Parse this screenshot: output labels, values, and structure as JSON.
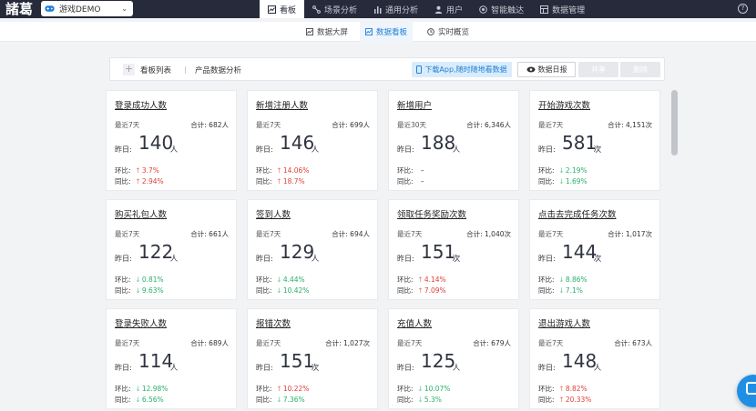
{
  "app": {
    "logo": "諸葛",
    "project": "游戏DEMO",
    "help": "?"
  },
  "topnav": [
    {
      "label": "看板",
      "icon": "dashboard-icon"
    },
    {
      "label": "场景分析",
      "icon": "scene-icon"
    },
    {
      "label": "通用分析",
      "icon": "bar-chart-icon"
    },
    {
      "label": "用户",
      "icon": "user-icon"
    },
    {
      "label": "智能触达",
      "icon": "target-icon"
    },
    {
      "label": "数据管理",
      "icon": "data-icon"
    }
  ],
  "subnav": [
    {
      "label": "数据大屏"
    },
    {
      "label": "数据看板"
    },
    {
      "label": "实时概览"
    }
  ],
  "toolbar": {
    "list_label": "看板列表",
    "dashboard_name": "产品数据分析",
    "download_app": "下载App,随时随地看数据",
    "daily_report": "数据日报",
    "share": "共享",
    "delete": "删除"
  },
  "labels": {
    "yesterday": "昨日:",
    "ring": "环比:",
    "yoy": "同比:"
  },
  "cards": [
    {
      "title": "登录成功人数",
      "period": "最近7天",
      "total": "合计: 682人",
      "value": "140",
      "unit": "人",
      "ring": "3.7%",
      "ring_dir": "up",
      "yoy": "2.94%",
      "yoy_dir": "up"
    },
    {
      "title": "新增注册人数",
      "period": "最近7天",
      "total": "合计: 699人",
      "value": "146",
      "unit": "人",
      "ring": "14.06%",
      "ring_dir": "up",
      "yoy": "18.7%",
      "yoy_dir": "up"
    },
    {
      "title": "新增用户",
      "period": "最近30天",
      "total": "合计: 6,346人",
      "value": "188",
      "unit": "人",
      "ring": "–",
      "ring_dir": "none",
      "yoy": "–",
      "yoy_dir": "none"
    },
    {
      "title": "开始游戏次数",
      "period": "最近7天",
      "total": "合计: 4,151次",
      "value": "581",
      "unit": "次",
      "ring": "2.19%",
      "ring_dir": "down",
      "yoy": "1.69%",
      "yoy_dir": "down"
    },
    {
      "title": "购买礼包人数",
      "period": "最近7天",
      "total": "合计: 661人",
      "value": "122",
      "unit": "人",
      "ring": "0.81%",
      "ring_dir": "down",
      "yoy": "9.63%",
      "yoy_dir": "down"
    },
    {
      "title": "签到人数",
      "period": "最近7天",
      "total": "合计: 694人",
      "value": "129",
      "unit": "人",
      "ring": "4.44%",
      "ring_dir": "down",
      "yoy": "10.42%",
      "yoy_dir": "down"
    },
    {
      "title": "领取任务奖励次数",
      "period": "最近7天",
      "total": "合计: 1,040次",
      "value": "151",
      "unit": "次",
      "ring": "4.14%",
      "ring_dir": "up",
      "yoy": "7.09%",
      "yoy_dir": "up"
    },
    {
      "title": "点击去完成任务次数",
      "period": "最近7天",
      "total": "合计: 1,017次",
      "value": "144",
      "unit": "次",
      "ring": "8.86%",
      "ring_dir": "down",
      "yoy": "7.1%",
      "yoy_dir": "down"
    },
    {
      "title": "登录失败人数",
      "period": "最近7天",
      "total": "合计: 689人",
      "value": "114",
      "unit": "人",
      "ring": "12.98%",
      "ring_dir": "down",
      "yoy": "6.56%",
      "yoy_dir": "down"
    },
    {
      "title": "报错次数",
      "period": "最近7天",
      "total": "合计: 1,027次",
      "value": "151",
      "unit": "次",
      "ring": "10.22%",
      "ring_dir": "up",
      "yoy": "7.36%",
      "yoy_dir": "down"
    },
    {
      "title": "充值人数",
      "period": "最近7天",
      "total": "合计: 679人",
      "value": "125",
      "unit": "人",
      "ring": "10.07%",
      "ring_dir": "down",
      "yoy": "5.3%",
      "yoy_dir": "down"
    },
    {
      "title": "退出游戏人数",
      "period": "最近7天",
      "total": "合计: 673人",
      "value": "148",
      "unit": "人",
      "ring": "8.82%",
      "ring_dir": "up",
      "yoy": "20.33%",
      "yoy_dir": "up"
    }
  ],
  "colors": {
    "up": "#e0403a",
    "down": "#27b06a",
    "accent": "#1f7fd6",
    "topbar": "#262a3a"
  }
}
